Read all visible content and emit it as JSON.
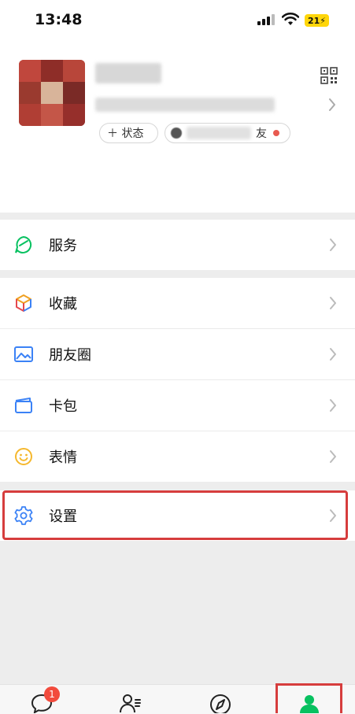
{
  "status_bar": {
    "time": "13:48",
    "battery": "21"
  },
  "profile": {
    "status_button": "＋ 状态",
    "friends_suffix": "友"
  },
  "menu": {
    "services": "服务",
    "favorites": "收藏",
    "moments": "朋友圈",
    "cards": "卡包",
    "stickers": "表情",
    "settings": "设置"
  },
  "tabbar": {
    "chats_badge": "1"
  },
  "colors": {
    "accent_green": "#07c160",
    "highlight_red": "#d63d3d"
  }
}
